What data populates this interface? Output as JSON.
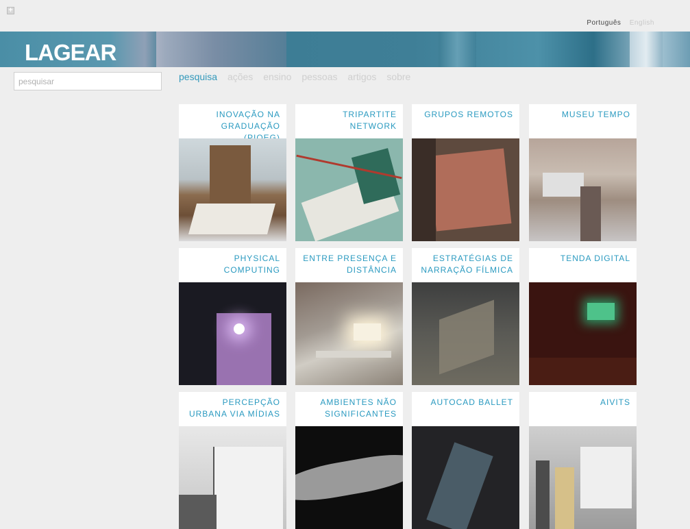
{
  "language": {
    "active": "Português",
    "inactive": "English"
  },
  "header": {
    "logo": "LAGEAR"
  },
  "search": {
    "placeholder": "pesquisar"
  },
  "nav": {
    "items": [
      {
        "label": "pesquisa",
        "active": true
      },
      {
        "label": "ações",
        "active": false
      },
      {
        "label": "ensino",
        "active": false
      },
      {
        "label": "pessoas",
        "active": false
      },
      {
        "label": "artigos",
        "active": false
      },
      {
        "label": "sobre",
        "active": false
      }
    ]
  },
  "projects": [
    {
      "title": "INOVAÇÃO NA GRADUAÇÃO (PIQEG)"
    },
    {
      "title": "TRIPARTITE NETWORK"
    },
    {
      "title": "GRUPOS REMOTOS"
    },
    {
      "title": "MUSEU TEMPO"
    },
    {
      "title": "PHYSICAL COMPUTING"
    },
    {
      "title": "ENTRE PRESENÇA E DISTÂNCIA"
    },
    {
      "title": "ESTRATÉGIAS DE NARRAÇÃO FÍLMICA"
    },
    {
      "title": "TENDA DIGITAL"
    },
    {
      "title": "PERCEPÇÃO URBANA VIA MÍDIAS"
    },
    {
      "title": "AMBIENTES NÃO SIGNIFICANTES"
    },
    {
      "title": "AUTOCAD BALLET"
    },
    {
      "title": "AIVITS"
    }
  ],
  "colors": {
    "accent": "#3399bb",
    "banner": "#3f7f97",
    "background": "#eeeeee"
  }
}
